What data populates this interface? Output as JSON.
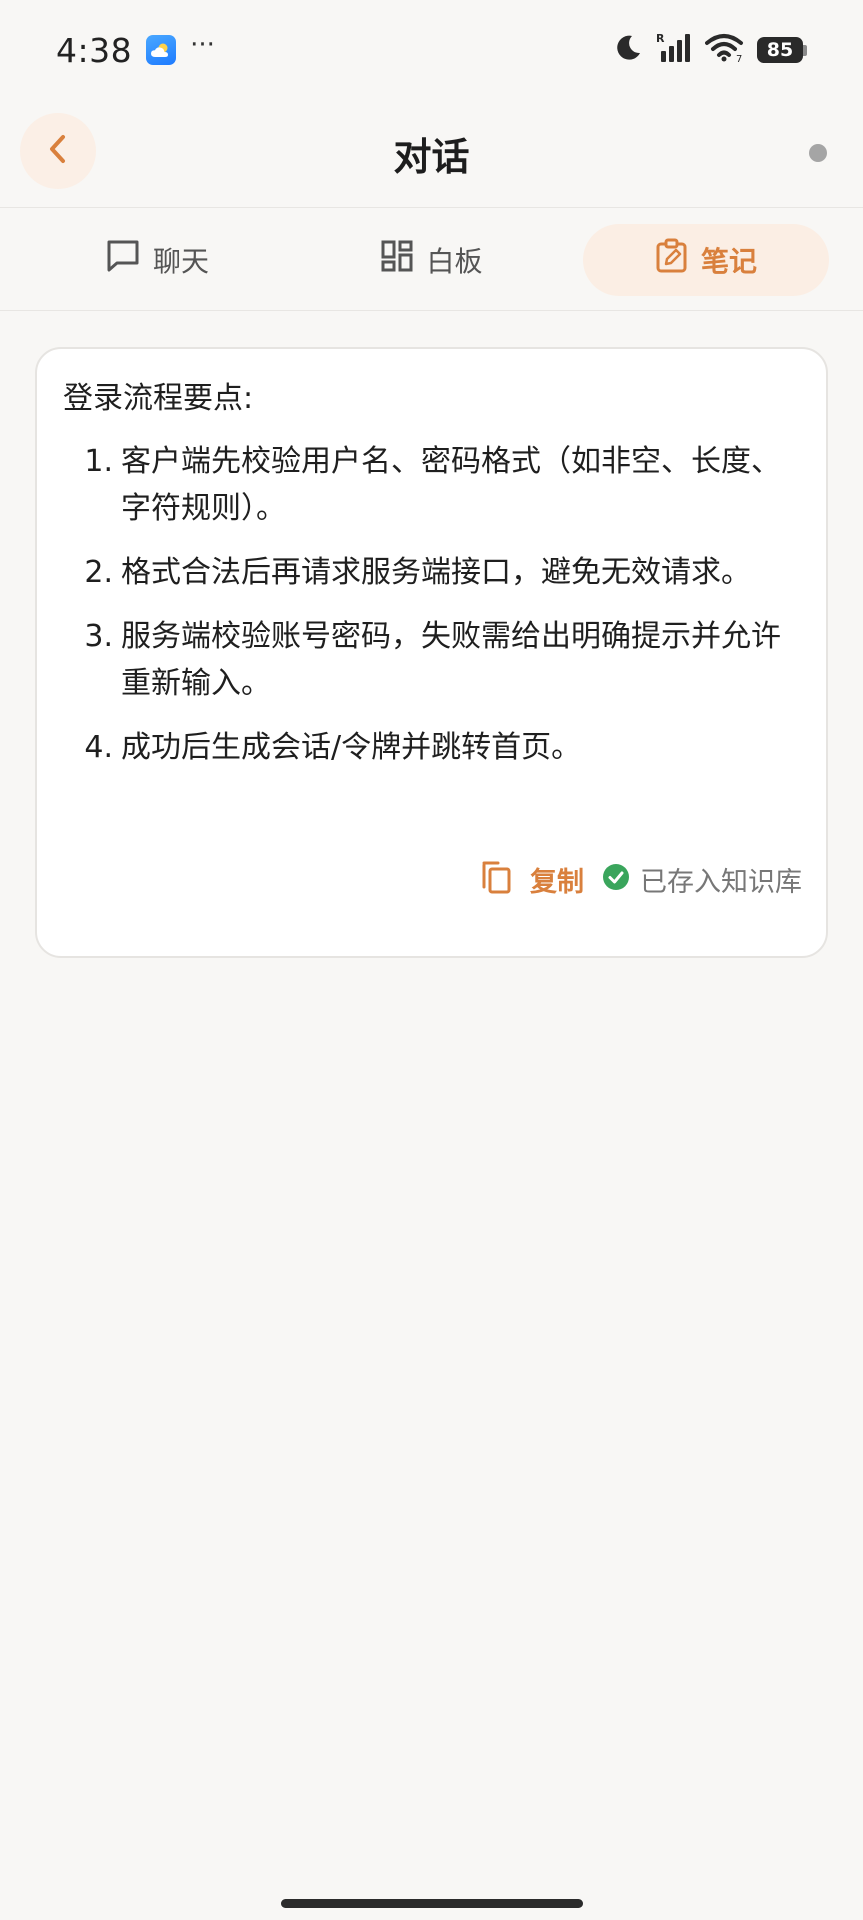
{
  "status_bar": {
    "time": "4:38",
    "more": "···",
    "signal_mark": "R",
    "wifi_mark": "7",
    "battery_level": "85",
    "icons": [
      "weather-app-icon",
      "moon-icon",
      "signal-icon",
      "wifi-icon",
      "battery-icon"
    ]
  },
  "header": {
    "title": "对话",
    "accent_color": "#d9803d"
  },
  "tabs": [
    {
      "label": "聊天",
      "icon": "chat-bubble-icon",
      "active": false
    },
    {
      "label": "白板",
      "icon": "grid-board-icon",
      "active": false
    },
    {
      "label": "笔记",
      "icon": "edit-note-icon",
      "active": true
    }
  ],
  "note": {
    "heading": "登录流程要点:",
    "items": [
      {
        "num": "1.",
        "text": "客户端先校验用户名、密码格式（如非空、长度、字符规则）。"
      },
      {
        "num": "2.",
        "text": "格式合法后再请求服务端接口，避免无效请求。"
      },
      {
        "num": "3.",
        "text": "服务端校验账号密码，失败需给出明确提示并允许重新输入。"
      },
      {
        "num": "4.",
        "text": "成功后生成会话/令牌并跳转首页。"
      }
    ],
    "copy_label": "复制",
    "saved_label": "已存入知识库",
    "saved_color": "#3aa55c"
  }
}
